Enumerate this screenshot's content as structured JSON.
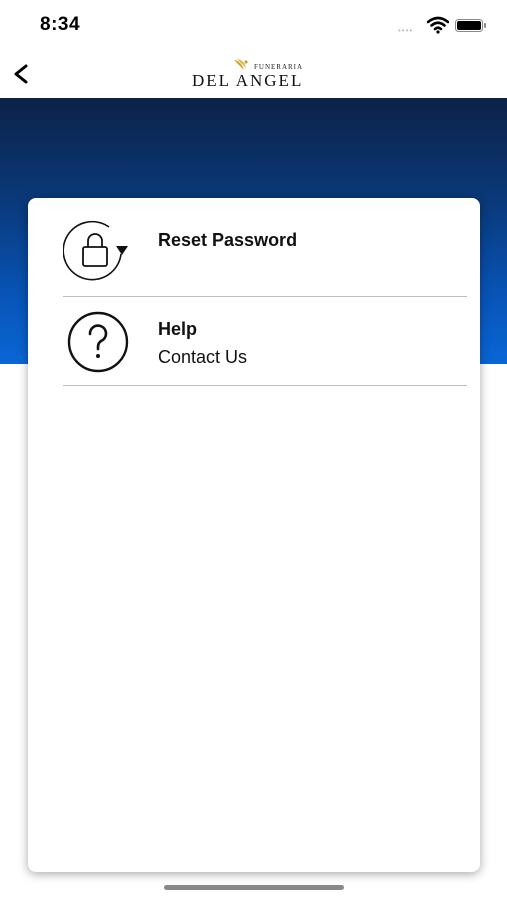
{
  "status_bar": {
    "time": "8:34",
    "signal_dots": "••••",
    "icons": [
      "wifi-icon",
      "battery-icon"
    ]
  },
  "nav": {
    "back_icon": "chevron-left-icon",
    "logo_small_text": "FUNERARIA",
    "logo_main_text": "DEL ANGEL"
  },
  "colors": {
    "header_gradient_top": "#0c2246",
    "header_gradient_bottom": "#0a66d6",
    "card_background": "#ffffff",
    "divider": "#bdbdbd",
    "logo_accent": "#c9a227"
  },
  "menu": {
    "items": [
      {
        "icon": "lock-reset-icon",
        "title": "Reset Password",
        "subtitle": ""
      },
      {
        "icon": "question-circle-icon",
        "title": "Help",
        "subtitle": "Contact Us"
      }
    ]
  }
}
